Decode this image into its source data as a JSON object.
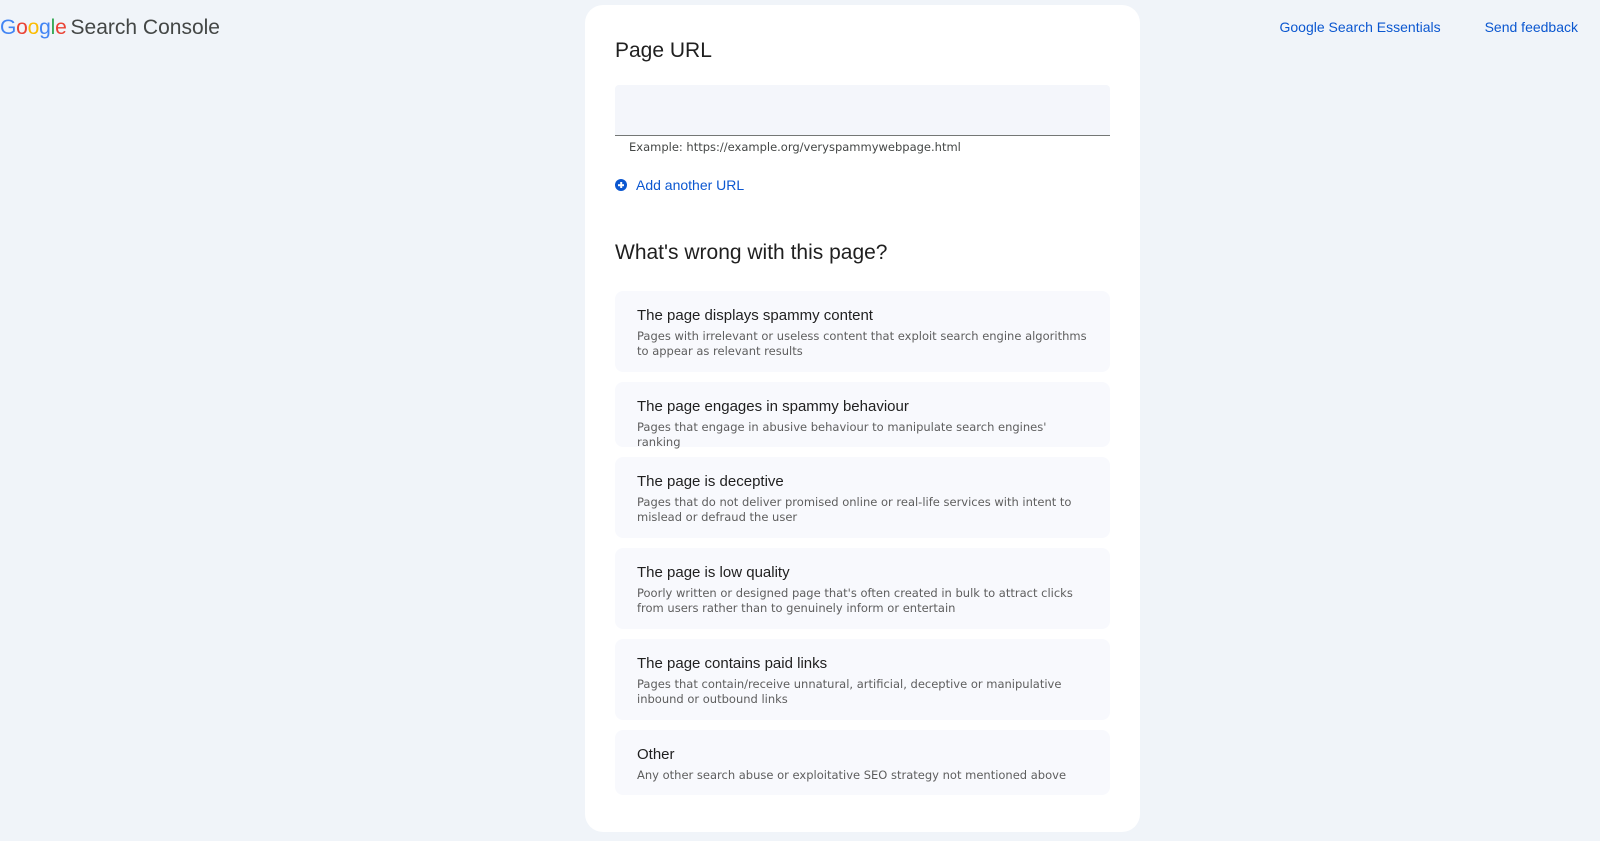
{
  "header": {
    "logo": {
      "letters": [
        "G",
        "o",
        "o",
        "g",
        "l",
        "e"
      ],
      "letter_colors": [
        "#4285f4",
        "#ea4335",
        "#fbbc04",
        "#4285f4",
        "#34a853",
        "#ea4335"
      ],
      "product": "Search Console"
    },
    "links": [
      {
        "label": "Google Search Essentials"
      },
      {
        "label": "Send feedback"
      }
    ]
  },
  "form": {
    "url_section_title": "Page URL",
    "url_input": {
      "value": "",
      "placeholder": ""
    },
    "url_helper": "Example: https://example.org/veryspammywebpage.html",
    "add_url_label": "Add another URL",
    "add_url_icon": "add-circle-icon",
    "issue_section_title": "What's wrong with this page?",
    "options": [
      {
        "title": "The page displays spammy content",
        "description": "Pages with irrelevant or useless content that exploit search engine algorithms to appear as relevant results"
      },
      {
        "title": "The page engages in spammy behaviour",
        "description": "Pages that engage in abusive behaviour to manipulate search engines' ranking"
      },
      {
        "title": "The page is deceptive",
        "description": "Pages that do not deliver promised online or real-life services with intent to mislead or defraud the user"
      },
      {
        "title": "The page is low quality",
        "description": "Poorly written or designed page that's often created in bulk to attract clicks from users rather than to genuinely inform or entertain"
      },
      {
        "title": "The page contains paid links",
        "description": "Pages that contain/receive unnatural, artificial, deceptive or manipulative inbound or outbound links"
      },
      {
        "title": "Other",
        "description": "Any other search abuse or exploitative SEO strategy not mentioned above"
      }
    ]
  },
  "colors": {
    "page_background": "#f0f4f9",
    "card_background": "#ffffff",
    "option_background": "#f8f9fd",
    "link_blue": "#0b57d0"
  }
}
